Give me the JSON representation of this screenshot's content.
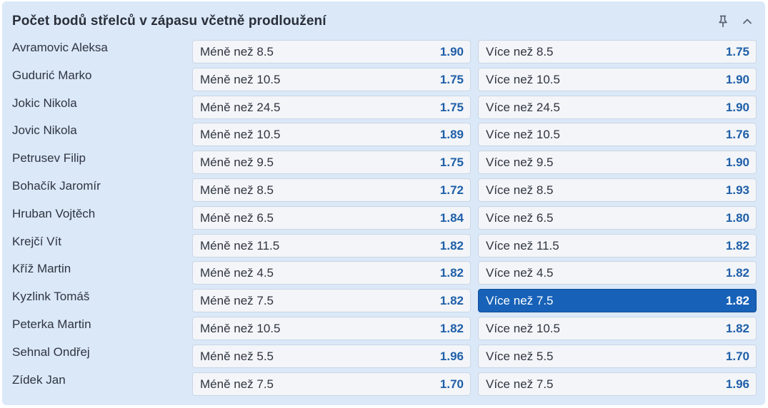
{
  "market": {
    "title": "Počet bodů střelců v zápasu včetně prodloužení",
    "pin_icon": "pin-icon",
    "collapse_icon": "chevron-up-icon"
  },
  "colors": {
    "panel_bg": "#dbe8f8",
    "button_bg": "#f3f5f8",
    "odds_text": "#1f5fa8",
    "selected_bg": "#1762b8"
  },
  "rows": [
    {
      "player": "Avramovic Aleksa",
      "under_label": "Méně než 8.5",
      "under_odds": "1.90",
      "over_label": "Více než 8.5",
      "over_odds": "1.75",
      "selected": ""
    },
    {
      "player": "Gudurić Marko",
      "under_label": "Méně než 10.5",
      "under_odds": "1.75",
      "over_label": "Více než 10.5",
      "over_odds": "1.90",
      "selected": ""
    },
    {
      "player": "Jokic Nikola",
      "under_label": "Méně než 24.5",
      "under_odds": "1.75",
      "over_label": "Více než 24.5",
      "over_odds": "1.90",
      "selected": ""
    },
    {
      "player": "Jovic Nikola",
      "under_label": "Méně než 10.5",
      "under_odds": "1.89",
      "over_label": "Více než 10.5",
      "over_odds": "1.76",
      "selected": ""
    },
    {
      "player": "Petrusev Filip",
      "under_label": "Méně než 9.5",
      "under_odds": "1.75",
      "over_label": "Více než 9.5",
      "over_odds": "1.90",
      "selected": ""
    },
    {
      "player": "Bohačík Jaromír",
      "under_label": "Méně než 8.5",
      "under_odds": "1.72",
      "over_label": "Více než 8.5",
      "over_odds": "1.93",
      "selected": ""
    },
    {
      "player": "Hruban Vojtěch",
      "under_label": "Méně než 6.5",
      "under_odds": "1.84",
      "over_label": "Více než 6.5",
      "over_odds": "1.80",
      "selected": ""
    },
    {
      "player": "Krejčí Vít",
      "under_label": "Méně než 11.5",
      "under_odds": "1.82",
      "over_label": "Více než 11.5",
      "over_odds": "1.82",
      "selected": ""
    },
    {
      "player": "Kříž Martin",
      "under_label": "Méně než 4.5",
      "under_odds": "1.82",
      "over_label": "Více než 4.5",
      "over_odds": "1.82",
      "selected": ""
    },
    {
      "player": "Kyzlink Tomáš",
      "under_label": "Méně než 7.5",
      "under_odds": "1.82",
      "over_label": "Více než 7.5",
      "over_odds": "1.82",
      "selected": "over"
    },
    {
      "player": "Peterka Martin",
      "under_label": "Méně než 10.5",
      "under_odds": "1.82",
      "over_label": "Více než 10.5",
      "over_odds": "1.82",
      "selected": ""
    },
    {
      "player": "Sehnal Ondřej",
      "under_label": "Méně než 5.5",
      "under_odds": "1.96",
      "over_label": "Více než 5.5",
      "over_odds": "1.70",
      "selected": ""
    },
    {
      "player": "Zídek Jan",
      "under_label": "Méně než 7.5",
      "under_odds": "1.70",
      "over_label": "Více než 7.5",
      "over_odds": "1.96",
      "selected": ""
    }
  ]
}
